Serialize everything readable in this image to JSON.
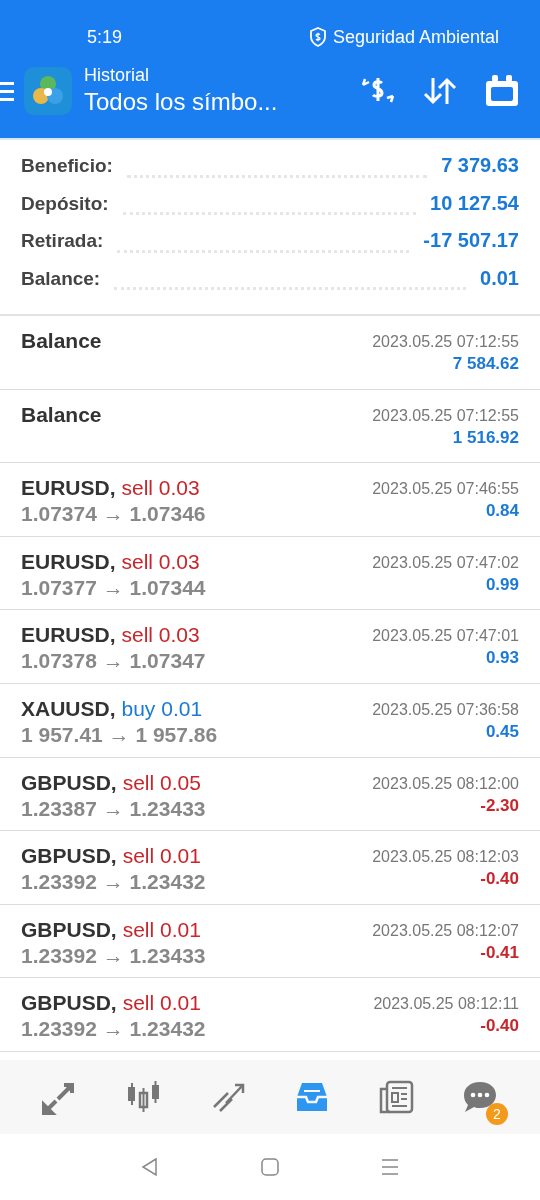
{
  "status_bar": {
    "time": "5:19",
    "security": "Seguridad Ambiental"
  },
  "header": {
    "title": "Historial",
    "subtitle": "Todos los símbo..."
  },
  "summary": [
    {
      "label": "Beneficio:",
      "value": "7 379.63"
    },
    {
      "label": "Depósito:",
      "value": "10 127.54"
    },
    {
      "label": "Retirada:",
      "value": "-17 507.17"
    },
    {
      "label": "Balance:",
      "value": "0.01"
    }
  ],
  "rows": [
    {
      "kind": "balance",
      "title": "Balance",
      "time": "2023.05.25 07:12:55",
      "profit": "7 584.62",
      "loss": false
    },
    {
      "kind": "balance",
      "title": "Balance",
      "time": "2023.05.25 07:12:55",
      "profit": "1 516.92",
      "loss": false
    },
    {
      "kind": "trade",
      "symbol": "EURUSD,",
      "side": "sell",
      "buy": false,
      "volume": "0.03",
      "prices": "1.07374 → 1.07346",
      "time": "2023.05.25 07:46:55",
      "profit": "0.84",
      "loss": false
    },
    {
      "kind": "trade",
      "symbol": "EURUSD,",
      "side": "sell",
      "buy": false,
      "volume": "0.03",
      "prices": "1.07377 → 1.07344",
      "time": "2023.05.25 07:47:02",
      "profit": "0.99",
      "loss": false
    },
    {
      "kind": "trade",
      "symbol": "EURUSD,",
      "side": "sell",
      "buy": false,
      "volume": "0.03",
      "prices": "1.07378 → 1.07347",
      "time": "2023.05.25 07:47:01",
      "profit": "0.93",
      "loss": false
    },
    {
      "kind": "trade",
      "symbol": "XAUUSD,",
      "side": "buy",
      "buy": true,
      "volume": "0.01",
      "prices": "1 957.41 → 1 957.86",
      "time": "2023.05.25 07:36:58",
      "profit": "0.45",
      "loss": false
    },
    {
      "kind": "trade",
      "symbol": "GBPUSD,",
      "side": "sell",
      "buy": false,
      "volume": "0.05",
      "prices": "1.23387 → 1.23433",
      "time": "2023.05.25 08:12:00",
      "profit": "-2.30",
      "loss": true
    },
    {
      "kind": "trade",
      "symbol": "GBPUSD,",
      "side": "sell",
      "buy": false,
      "volume": "0.01",
      "prices": "1.23392 → 1.23432",
      "time": "2023.05.25 08:12:03",
      "profit": "-0.40",
      "loss": true
    },
    {
      "kind": "trade",
      "symbol": "GBPUSD,",
      "side": "sell",
      "buy": false,
      "volume": "0.01",
      "prices": "1.23392 → 1.23433",
      "time": "2023.05.25 08:12:07",
      "profit": "-0.41",
      "loss": true
    },
    {
      "kind": "trade",
      "symbol": "GBPUSD,",
      "side": "sell",
      "buy": false,
      "volume": "0.01",
      "prices": "1.23392 → 1.23432",
      "time": "2023.05.25 08:12:11",
      "profit": "-0.40",
      "loss": true
    }
  ],
  "bottom_nav": [
    {
      "kind": "quotes",
      "selected": false
    },
    {
      "kind": "chart",
      "selected": false
    },
    {
      "kind": "trade",
      "selected": false
    },
    {
      "kind": "history",
      "selected": true
    },
    {
      "kind": "news",
      "selected": false
    },
    {
      "kind": "chat",
      "selected": false,
      "badge": "2"
    }
  ]
}
